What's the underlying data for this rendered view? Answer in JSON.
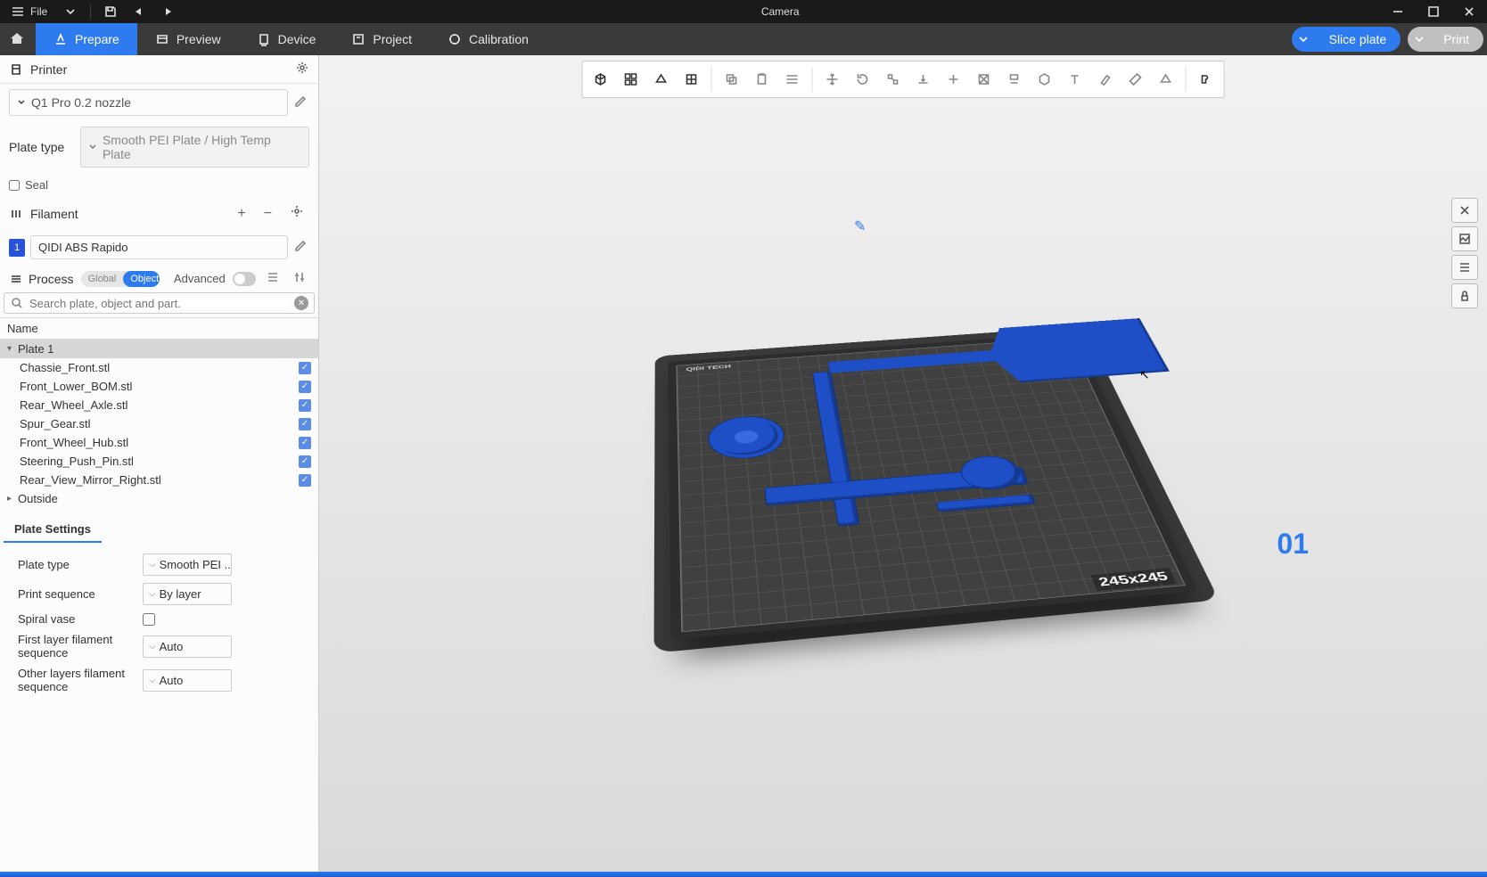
{
  "titlebar": {
    "file_label": "File",
    "window_title": "Camera"
  },
  "tabs": {
    "prepare": "Prepare",
    "preview": "Preview",
    "device": "Device",
    "project": "Project",
    "calibration": "Calibration"
  },
  "actions": {
    "slice": "Slice plate",
    "print": "Print"
  },
  "sidebar": {
    "printer_section": "Printer",
    "printer_name": "Q1 Pro 0.2 nozzle",
    "plate_type_label": "Plate type",
    "plate_type_value": "Smooth PEI Plate / High Temp Plate",
    "seal_label": "Seal",
    "filament_section": "Filament",
    "filament_index": "1",
    "filament_name": "QIDI ABS Rapido",
    "process_section": "Process",
    "pill_global": "Global",
    "pill_objects": "Objects",
    "advanced_label": "Advanced",
    "search_placeholder": "Search plate, object and part.",
    "tree_col_name": "Name",
    "tree": {
      "plate1": "Plate 1",
      "items": [
        "Chassie_Front.stl",
        "Front_Lower_BOM.stl",
        "Rear_Wheel_Axle.stl",
        "Spur_Gear.stl",
        "Front_Wheel_Hub.stl",
        "Steering_Push_Pin.stl",
        "Rear_View_Mirror_Right.stl"
      ],
      "outside": "Outside"
    },
    "plate_settings": {
      "header": "Plate Settings",
      "plate_type_label": "Plate type",
      "plate_type_value": "Smooth PEI ...",
      "print_seq_label": "Print sequence",
      "print_seq_value": "By layer",
      "spiral_label": "Spiral vase",
      "first_layer_label": "First layer filament sequence",
      "first_layer_value": "Auto",
      "other_layers_label": "Other layers filament sequence",
      "other_layers_value": "Auto"
    }
  },
  "viewport": {
    "brand": "QIDI TECH",
    "bed_size": "245x245",
    "plate_number": "01"
  }
}
